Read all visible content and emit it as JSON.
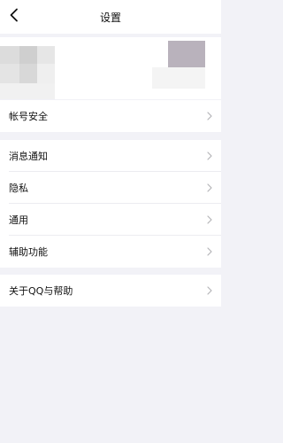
{
  "header": {
    "title": "设置",
    "back_icon": "chevron-left-icon"
  },
  "groups": [
    {
      "items": [
        {
          "label": "帐号安全",
          "icon": "chevron-right-icon"
        }
      ]
    },
    {
      "items": [
        {
          "label": "消息通知",
          "icon": "chevron-right-icon"
        },
        {
          "label": "隐私",
          "icon": "chevron-right-icon"
        },
        {
          "label": "通用",
          "icon": "chevron-right-icon"
        },
        {
          "label": "辅助功能",
          "icon": "chevron-right-icon"
        }
      ]
    },
    {
      "items": [
        {
          "label": "关于QQ与帮助",
          "icon": "chevron-right-icon"
        }
      ]
    }
  ],
  "colors": {
    "background": "#f2f2f7",
    "surface": "#ffffff",
    "text": "#111111",
    "chevron": "#b5b5b9"
  }
}
